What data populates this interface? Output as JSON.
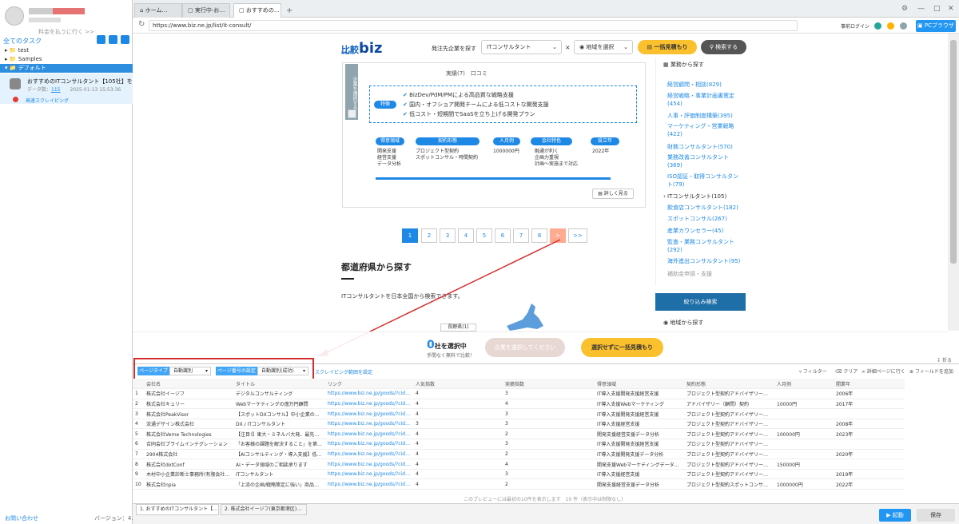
{
  "sidebar": {
    "upgrade_text": "料金を払うに行く >>",
    "all_tasks": "全てのタスク",
    "tree": [
      "test",
      "Samples",
      "デフォルト"
    ],
    "task": {
      "title": "おすすめのITコンサルタント【105社】を…",
      "data_label": "データ数：",
      "data_count": "115",
      "date": "2025-01-13 15:53:36",
      "status": "高速スクレイピング"
    },
    "contact": "お問い合わせ",
    "version": "バージョン：4.0.2"
  },
  "browser": {
    "tabs": [
      "ホーム…",
      "実行中-お…",
      "おすすめの…"
    ],
    "url": "https://www.biz.ne.jp/list/it-consult/",
    "login": "事前ログイン",
    "pc_browser": "PCブラウザ"
  },
  "site": {
    "logo_text": "比較",
    "logo_sub": "hikaku",
    "logo_biz": "biz",
    "search_label": "発注先企業を探す",
    "category_select": "ITコンサルタント",
    "x": "×",
    "area_select": "地域を選択",
    "estimate_btn": "一括見積もり",
    "search_btn": "検索する",
    "select_company": "企業を選択する",
    "pills": "実績(7)　口コミ",
    "feature_badge": "特徴",
    "features": [
      "BizDev/PdM/PMによる高品質な戦略支援",
      "国内・オフショア開発チームによる低コストな開発支援",
      "低コスト・短期間でSaaSを立ち上げる開発プラン"
    ],
    "attrs": [
      {
        "h": "得意領域",
        "v": [
          "開発支援",
          "経営支援",
          "データ分析"
        ]
      },
      {
        "h": "契約形態",
        "v": [
          "プロジェクト型契約",
          "スポットコンサル・時間契約"
        ]
      },
      {
        "h": "人月例",
        "v": [
          "1000000円"
        ]
      },
      {
        "h": "会社特色",
        "v": [
          "融通が利く",
          "企画力重視",
          "計画〜実施まで対応"
        ]
      },
      {
        "h": "設立年",
        "v": [
          "2022年"
        ]
      }
    ],
    "detail_btn": "詳しく見る",
    "pages": [
      "1",
      "2",
      "3",
      "4",
      "5",
      "6",
      "7",
      "8",
      ">",
      ">>"
    ],
    "pref_title": "都道府県から探す",
    "pref_text": "ITコンサルタントを日本全国から検索できます。",
    "region_label": "長野県(1)",
    "right_header": "業務から探す",
    "right_links": [
      "経営顧問・相談(829)",
      "経営戦略・事業計画書策定(454)",
      "人事・評価制度構築(395)",
      "マーケティング・営業戦略(422)",
      "財務コンサルタント(570)",
      "業務改善コンサルタント(369)",
      "ISO認証・取得コンサルタント(79)"
    ],
    "right_current": "ITコンサルタント(105)",
    "right_links2": [
      "飲食店コンサルタント(182)",
      "スポットコンサル(267)",
      "産業カウンセラー(45)",
      "監査・業務コンサルタント(292)",
      "海外進出コンサルタント(95)"
    ],
    "right_gray": "補助金申請・支援",
    "narrow_btn": "絞り込み検索",
    "region_search": "地域から探す",
    "count_num": "0",
    "count_text": "社を選択中",
    "count_sub": "手間なく無料で比較！",
    "select_btn": "企業を選択してください",
    "all_btn": "選択せずに一括見積もり"
  },
  "panel": {
    "page_type_label": "ページタイプ",
    "page_type_value": "自動識別",
    "page_num_label": "ページ番号の設定",
    "page_num_value": "自動識別(成功)",
    "scrape_link": "スクレイピング範囲を設定",
    "tools": [
      "フィルター",
      "クリア",
      "詳細ページに行く",
      "フィールドを追加"
    ],
    "fold": "折る",
    "columns": [
      "",
      "会社名",
      "タイトル",
      "リンク",
      "人気指数",
      "実績指数",
      "得意領域",
      "契約形態",
      "人月例",
      "開業年"
    ],
    "rows": [
      [
        "1",
        "株式会社イージフ",
        "デジタルコンサルティング",
        "https://www.biz.ne.jp/goods/?cid=103698…",
        "4",
        "3",
        "IT導入支援開発支援経営支援",
        "プロジェクト型契約アドバイザリー（顧問…",
        "",
        "2006年"
      ],
      [
        "2",
        "株式会社キュリー",
        "Webマーケティングの億万円顧問",
        "https://www.biz.ne.jp/goods/?cid=104016…",
        "4",
        "4",
        "IT導入支援Webマーケティング",
        "アドバイザリー（顧問）契約",
        "10000円",
        "2017年"
      ],
      [
        "3",
        "株式会社PeakVisor",
        "【スポットDXコンサル】中小企業のた…",
        "https://www.biz.ne.jp/goods/?cid=102775…",
        "4",
        "3",
        "IT導入支援開発支援経営支援",
        "プロジェクト型契約アドバイザリー（顧問…",
        "",
        ""
      ],
      [
        "4",
        "流通デザイン株式会社",
        "DX / ITコンサルタント",
        "https://www.biz.ne.jp/goods/?cid=103214…",
        "3",
        "3",
        "IT導入支援経営支援",
        "プロジェクト型契約アドバイザリー（顧問…",
        "",
        "2008年"
      ],
      [
        "5",
        "株式会社Verne Technologies",
        "【注目!】東大・ミネルバ大発、最先端IT…",
        "https://www.biz.ne.jp/goods/?cid=104059…",
        "4",
        "2",
        "開発支援経営支援データ分析",
        "プロジェクト型契約アドバイザリー（顧問…",
        "100000円",
        "2023年"
      ],
      [
        "6",
        "合同会社プライムインテグレーション",
        "「お客様の課題を解決すること」を第一…",
        "https://www.biz.ne.jp/goods/?cid=104116…",
        "4",
        "3",
        "IT導入支援開発支援経営支援",
        "プロジェクト型契約アドバイザリー（顧問…",
        "",
        ""
      ],
      [
        "7",
        "2904株式会社",
        "【AIコンサルティング・導入支援】低額…",
        "https://www.biz.ne.jp/goods/?cid=104312…",
        "4",
        "2",
        "IT導入支援開発支援データ分析",
        "プロジェクト型契約アドバイザリー（顧問…",
        "",
        "2020年"
      ],
      [
        "8",
        "株式会社dotConf",
        "AI・データ領域のご相談承ります",
        "https://www.biz.ne.jp/goods/?cid=103218…",
        "4",
        "4",
        "開発支援Webマーケティングデータ分析",
        "プロジェクト型契約アドバイザリー（顧問…",
        "150000円",
        ""
      ],
      [
        "9",
        "木村中小企業診断士事務所(有限会社エ…",
        "ITコンサルタント",
        "https://www.biz.ne.jp/goods/?cid=103974…",
        "4",
        "3",
        "IT導入支援経営支援",
        "プロジェクト型契約アドバイザリー（顧問…",
        "",
        "2019年"
      ],
      [
        "10",
        "株式会社npia",
        "「上流の企画/戦略策定に強い」商品費…",
        "https://www.biz.ne.jp/goods/?cid=104384…",
        "4",
        "2",
        "開発支援経営支援データ分析",
        "プロジェクト型契約スポットコンサル・時…",
        "1000000円",
        "2022年"
      ]
    ],
    "footer_note": "このプレビューには最初の10件を表示します　10 件（表示中は制限なし）"
  },
  "bottom": {
    "tabs": [
      "1. おすすめのITコンサルタント【…",
      "2. 株式会社イージフ(東京都港区)…"
    ],
    "run": "起動",
    "save": "保存"
  }
}
